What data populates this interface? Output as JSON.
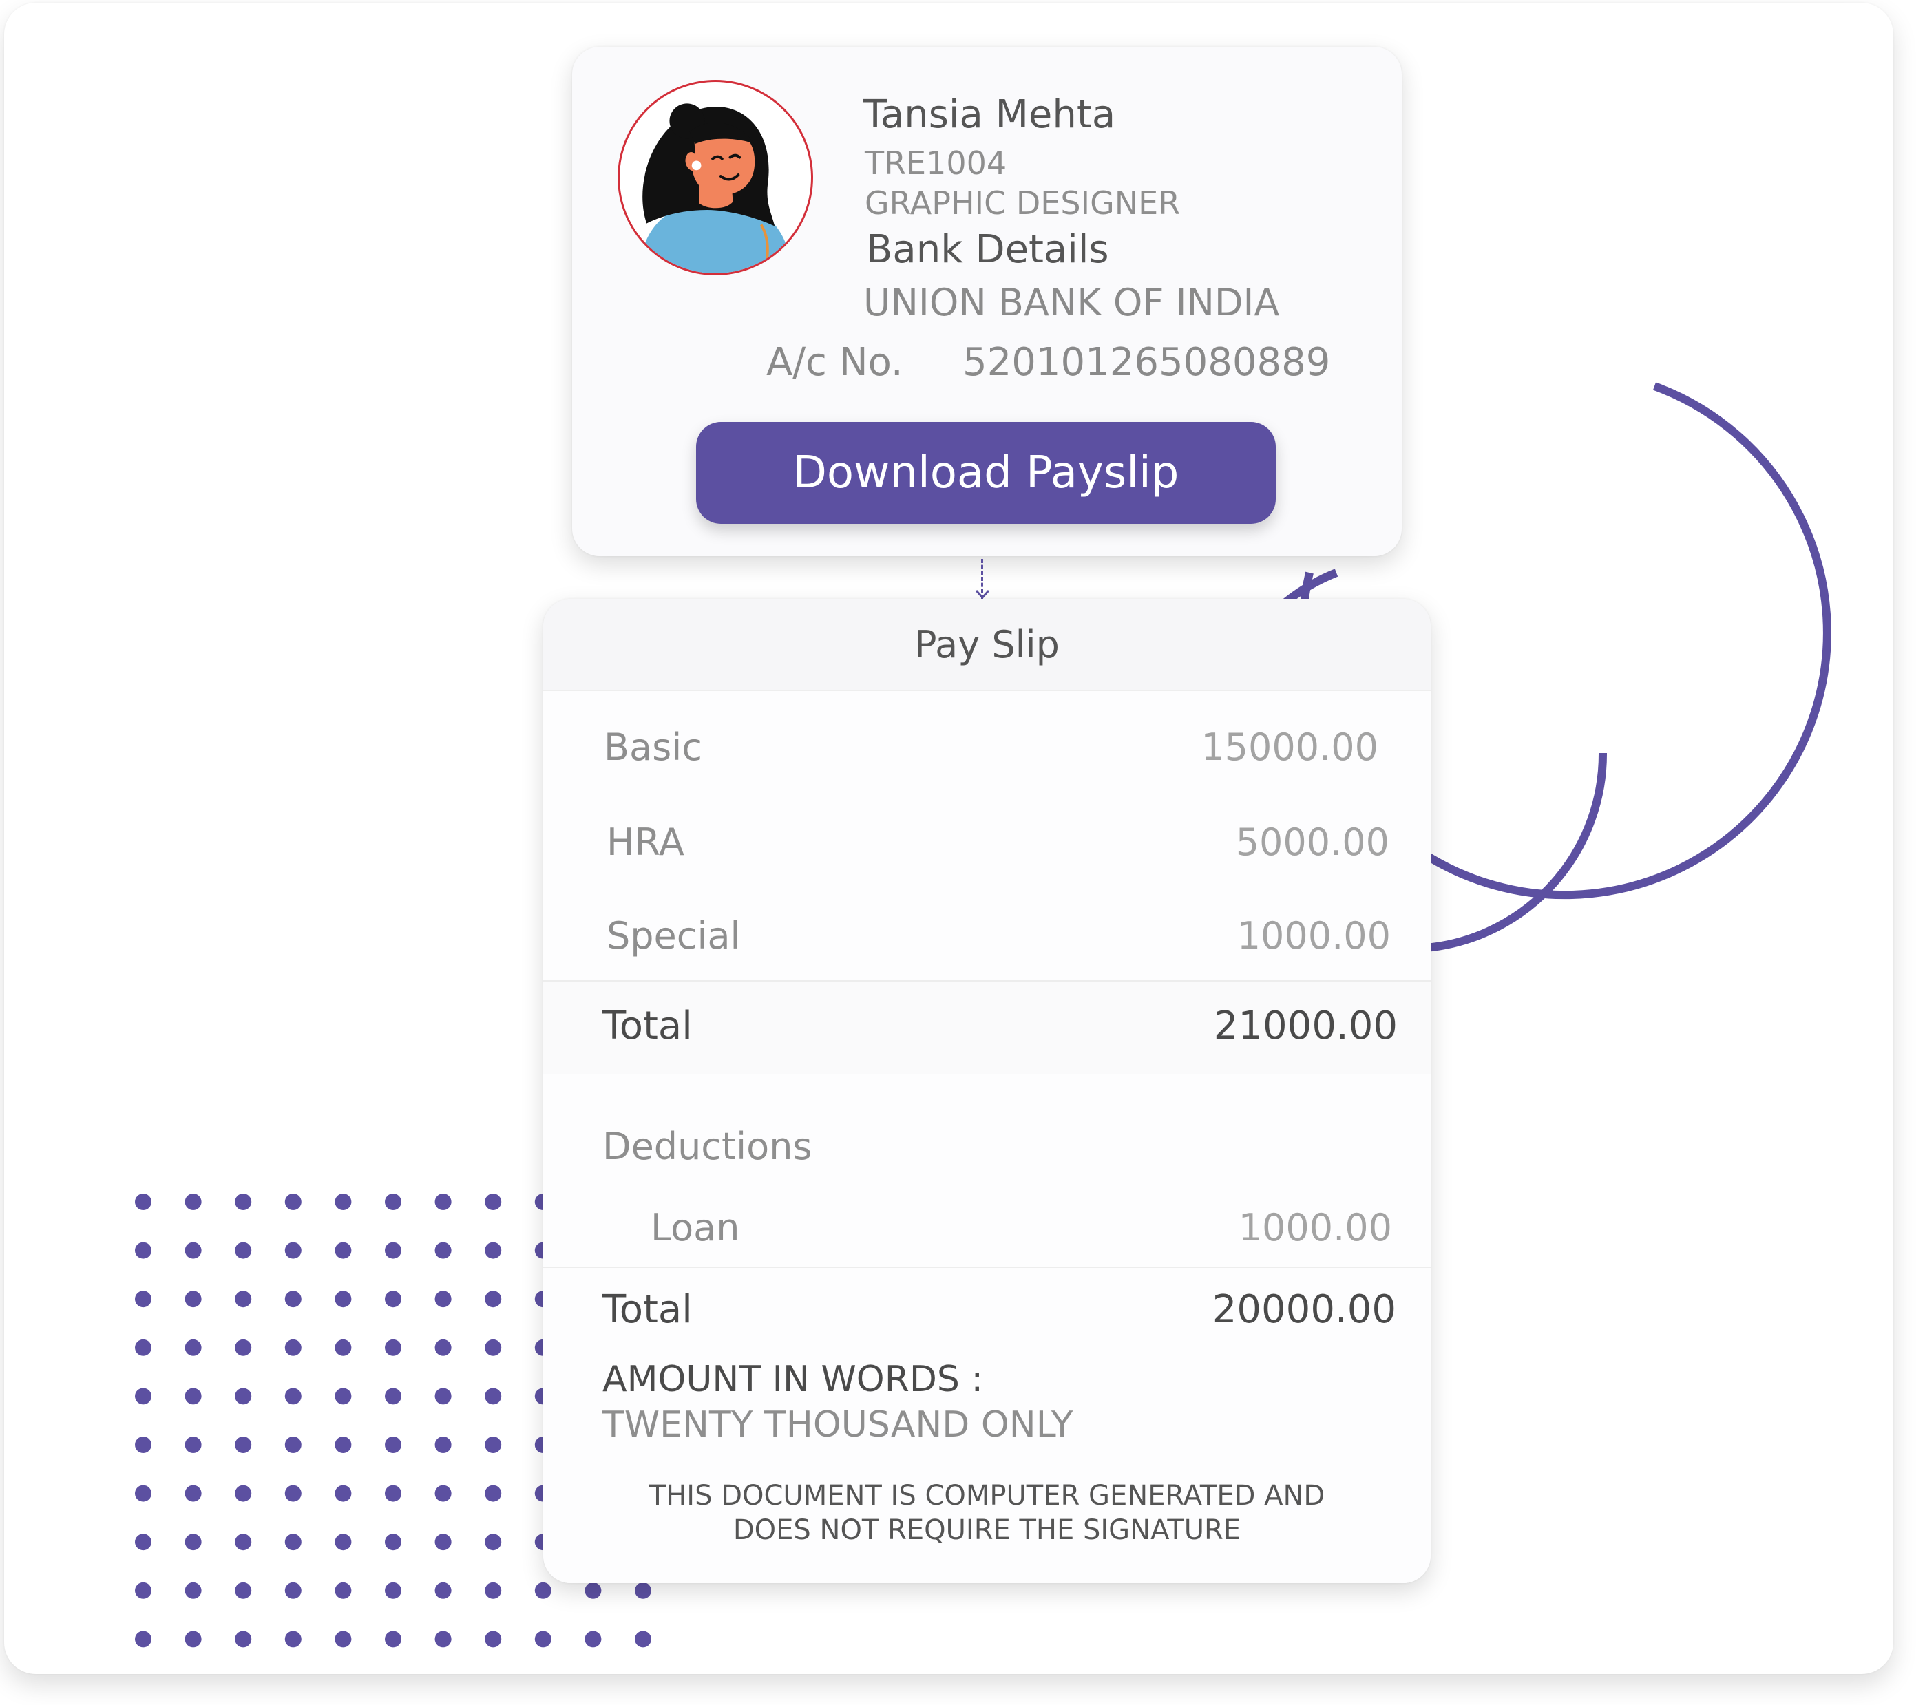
{
  "profile": {
    "name": "Tansia Mehta",
    "employee_id": "TRE1004",
    "designation": "GRAPHIC DESIGNER",
    "bank_heading": "Bank Details",
    "bank_name": "UNION BANK OF INDIA",
    "account_label": "A/c No.",
    "account_number": "520101265080889",
    "avatar_icon": "woman-avatar-icon"
  },
  "actions": {
    "download_label": "Download Payslip"
  },
  "payslip": {
    "title": "Pay Slip",
    "earnings": [
      {
        "label": "Basic",
        "value": "15000.00"
      },
      {
        "label": "HRA",
        "value": "5000.00"
      },
      {
        "label": "Special",
        "value": "1000.00"
      }
    ],
    "earnings_total_label": "Total",
    "earnings_total_value": "21000.00",
    "deductions_heading": "Deductions",
    "deductions": [
      {
        "label": "Loan",
        "value": "1000.00"
      }
    ],
    "net_total_label": "Total",
    "net_total_value": "20000.00",
    "amount_words_label": "AMOUNT IN WORDS :",
    "amount_words_value": "TWENTY THOUSAND ONLY",
    "footer_line1": "THIS DOCUMENT IS COMPUTER GENERATED AND",
    "footer_line2": "DOES NOT REQUIRE THE SIGNATURE"
  },
  "colors": {
    "accent": "#5c50a1",
    "avatar_border": "#d32f3a",
    "text_dark": "#4a4a4a",
    "text_muted": "#8e8e8e"
  }
}
